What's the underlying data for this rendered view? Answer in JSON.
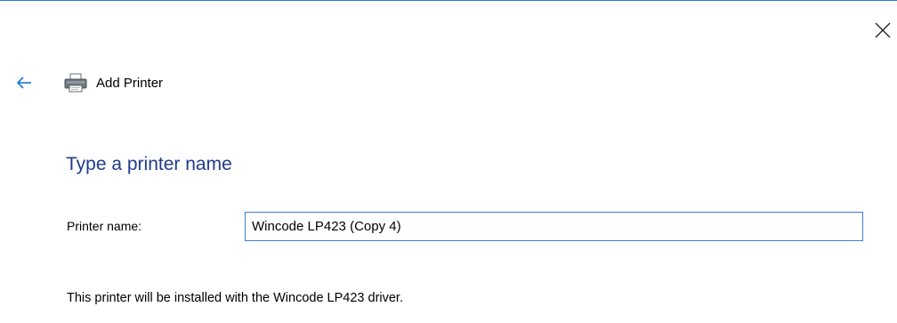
{
  "window": {
    "title": "Add Printer",
    "close_icon": "close-icon",
    "back_icon": "back-arrow-icon",
    "printer_icon": "printer-icon"
  },
  "page": {
    "heading": "Type a printer name",
    "printer_name_label": "Printer name:",
    "printer_name_value": "Wincode LP423 (Copy 4)",
    "driver_info": "This printer will be installed with the Wincode LP423 driver."
  },
  "colors": {
    "accent": "#2b7cd3",
    "heading": "#1e3c8c",
    "input_border": "#3c7fd1"
  }
}
